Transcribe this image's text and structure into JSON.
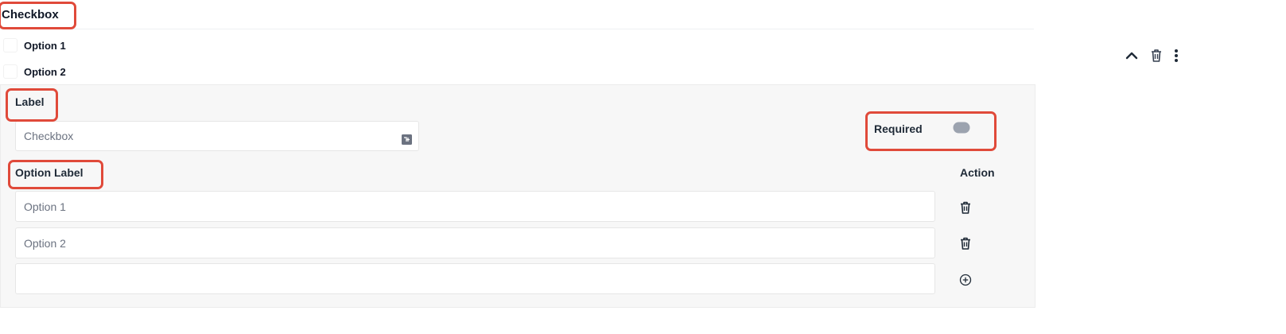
{
  "field": {
    "title": "Checkbox",
    "options_preview": [
      {
        "label": "Option 1",
        "checked": false
      },
      {
        "label": "Option 2",
        "checked": false
      }
    ]
  },
  "settings": {
    "label_title": "Label",
    "label_value": "Checkbox",
    "required_label": "Required",
    "required_on": false,
    "option_label_header": "Option Label",
    "action_header": "Action",
    "options": [
      {
        "value": "Option 1",
        "action_icon": "trash-icon"
      },
      {
        "value": "Option 2",
        "action_icon": "trash-icon"
      },
      {
        "value": "",
        "action_icon": "plus-circle-icon"
      }
    ]
  },
  "toolbar_icons": [
    "chevron-up-icon",
    "trash-icon",
    "kebab-menu-icon"
  ],
  "colors": {
    "annotation": "#e04a3a",
    "panel_bg": "#f7f7f7",
    "icon": "#1f2a37"
  }
}
